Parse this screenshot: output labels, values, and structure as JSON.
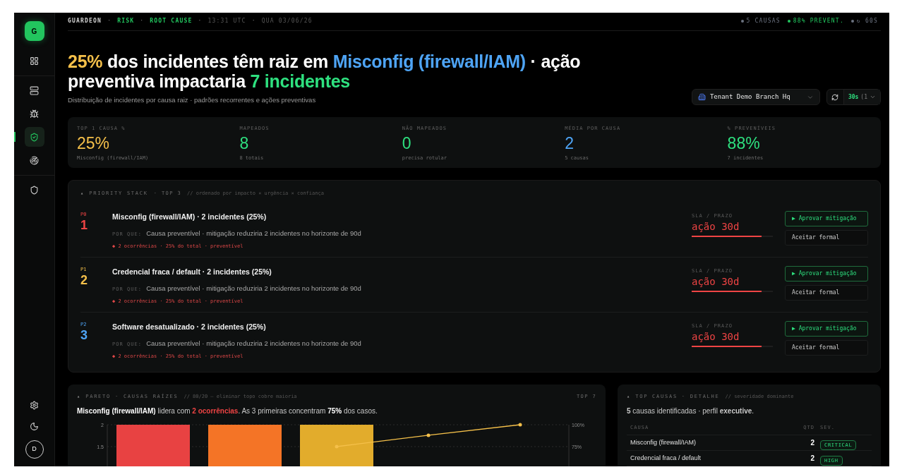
{
  "sidebar": {
    "logo": "G",
    "groups": [
      [
        {
          "selected": false
        }
      ],
      [
        {
          "selected": false
        },
        {
          "selected": false
        },
        {
          "selected": true
        },
        {
          "selected": false
        }
      ],
      [
        {
          "selected": false
        }
      ]
    ],
    "footer": [
      {
        "selected": false
      },
      {
        "selected": false
      }
    ],
    "avatar": "D"
  },
  "topbar": {
    "items": [
      {
        "text": "GUARDEON",
        "kind": "brand"
      },
      {
        "text": "·",
        "kind": "sep"
      },
      {
        "text": "RISK",
        "kind": "crumb"
      },
      {
        "text": "·",
        "kind": "sep"
      },
      {
        "text": "ROOT CAUSE",
        "kind": "crumb"
      },
      {
        "text": "·",
        "kind": "sep"
      },
      {
        "text": "13:31 UTC",
        "kind": "meta"
      },
      {
        "text": "·",
        "kind": "sep"
      },
      {
        "text": "QUA 03/06/26",
        "kind": "meta"
      }
    ],
    "status": [
      {
        "text": "5 CAUSAS",
        "color": "#6b7280"
      },
      {
        "text": "88% PREVENT.",
        "color": "#22c55e"
      },
      {
        "text": "↻ 60S",
        "color": "#6b7280"
      }
    ]
  },
  "headline": {
    "parts": [
      {
        "text": "25%",
        "kind": "warn"
      },
      {
        "text": " dos incidentes têm raiz em ",
        "kind": "plain"
      },
      {
        "text": "Misconfig (firewall/IAM)",
        "kind": "info"
      },
      {
        "text": " · ação preventiva impactaria ",
        "kind": "plain"
      },
      {
        "text": "7 incidentes",
        "kind": "good"
      }
    ],
    "subtitle": "Distribuição de incidentes por causa raiz · padrões recorrentes e ações preventivas"
  },
  "tenant": {
    "value": "Tenant Demo Branch Hq"
  },
  "refresh": {
    "interval": "30s",
    "hint": "(1"
  },
  "kpis": [
    {
      "label": "TOP 1 CAUSA %",
      "value": "25%",
      "sub": "Misconfig (firewall/IAM)",
      "color": "#f5c04a"
    },
    {
      "label": "MAPEADOS",
      "value": "8",
      "sub": "8 totais",
      "color": "#2ee07f"
    },
    {
      "label": "NÃO MAPEADOS",
      "value": "0",
      "sub": "precisa rotular",
      "color": "#2ee07f"
    },
    {
      "label": "MÉDIA POR CAUSA",
      "value": "2",
      "sub": "5 causas",
      "color": "#4ea4f5"
    },
    {
      "label": "% PREVENÍVEIS",
      "value": "88%",
      "sub": "7 incidentes",
      "color": "#2ee07f"
    }
  ],
  "priority": {
    "marker": "▴",
    "title": "PRIORITY STACK",
    "tag": "· TOP 3",
    "comment": "// ordenado por impacto × urgência × confiança",
    "items": [
      {
        "priority": "P0",
        "rank": "1",
        "color": "#ef4444",
        "title": "Misconfig (firewall/IAM) · 2 incidentes (25%)",
        "why_label": "POR QUE:",
        "why": "Causa preventível · mitigação reduziria 2 incidentes no horizonte de 90d",
        "meta": "◆ 2 ocorrências · 25% do total · preventível",
        "sla_label": "SLA / PRAZO",
        "sla": "ação 30d",
        "level": 0.86,
        "approve": "▶ Aprovar mitigação",
        "accept": "Aceitar formal"
      },
      {
        "priority": "P1",
        "rank": "2",
        "color": "#f5c04a",
        "title": "Credencial fraca / default · 2 incidentes (25%)",
        "why_label": "POR QUE:",
        "why": "Causa preventível · mitigação reduziria 2 incidentes no horizonte de 90d",
        "meta": "◆ 2 ocorrências · 25% do total · preventível",
        "sla_label": "SLA / PRAZO",
        "sla": "ação 30d",
        "level": 0.86,
        "approve": "▶ Aprovar mitigação",
        "accept": "Aceitar formal"
      },
      {
        "priority": "P2",
        "rank": "3",
        "color": "#4ea4f5",
        "title": "Software desatualizado · 2 incidentes (25%)",
        "why_label": "POR QUE:",
        "why": "Causa preventível · mitigação reduziria 2 incidentes no horizonte de 90d",
        "meta": "◆ 2 ocorrências · 25% do total · preventível",
        "sla_label": "SLA / PRAZO",
        "sla": "ação 30d",
        "level": 0.86,
        "approve": "▶ Aprovar mitigação",
        "accept": "Aceitar formal"
      }
    ]
  },
  "pareto": {
    "marker": "▴",
    "title": "PARETO · CAUSAS RAÍZES",
    "comment": "// 80/20 — eliminar topo cobre maioria",
    "tag": "TOP 7",
    "summary": [
      {
        "text": "Misconfig (firewall/IAM)",
        "kind": "strong"
      },
      {
        "text": " lidera com ",
        "kind": "plain"
      },
      {
        "text": "2 ocorrências",
        "kind": "alert"
      },
      {
        "text": ". As 3 primeiras concentram ",
        "kind": "plain"
      },
      {
        "text": "75%",
        "kind": "strong"
      },
      {
        "text": " dos casos.",
        "kind": "plain"
      }
    ],
    "chart_data": {
      "type": "bar",
      "ylim": [
        0,
        2
      ],
      "yticks": [
        1.5,
        2
      ],
      "y2lim": [
        0,
        100
      ],
      "y2ticks": [
        {
          "value": 75,
          "label": "75%"
        },
        {
          "value": 100,
          "label": "100%"
        }
      ],
      "series": [
        {
          "color": "#e84242",
          "values": [
            2,
            null,
            null,
            null,
            null
          ]
        },
        {
          "color": "#f47426",
          "values": [
            null,
            2,
            null,
            null,
            null
          ]
        },
        {
          "color": "#e2ac2c",
          "values": [
            null,
            null,
            2,
            null,
            null
          ]
        },
        {
          "type": "line",
          "axis": "y2",
          "color": "#f5c04a",
          "values": [
            null,
            null,
            75,
            88,
            100
          ]
        }
      ]
    }
  },
  "causes": {
    "marker": "▴",
    "title": "TOP CAUSAS · DETALHE",
    "comment": "// severidade dominante",
    "summary": "**5** causas identificadas · perfil **executive**.",
    "columns": [
      "CAUSA",
      "QTD",
      "SEV."
    ],
    "rows": [
      {
        "cause": "Misconfig (firewall/IAM)",
        "qty": "2",
        "sev": "CRITICAL"
      },
      {
        "cause": "Credencial fraca / default",
        "qty": "2",
        "sev": "HIGH"
      }
    ]
  }
}
